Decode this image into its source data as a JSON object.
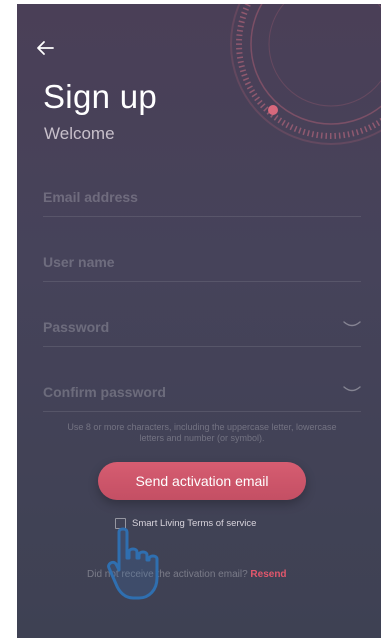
{
  "header": {
    "back_icon": "arrow-left-icon",
    "title": "Sign up",
    "subtitle": "Welcome"
  },
  "form": {
    "email_placeholder": "Email address",
    "username_placeholder": "User name",
    "password_placeholder": "Password",
    "confirm_password_placeholder": "Confirm password",
    "password_hint": "Use 8 or more characters, including the uppercase letter, lowercase letters and number (or symbol).",
    "toggle_icon": "eye-closed-icon"
  },
  "actions": {
    "send_label": "Send activation email",
    "terms_label": "Smart Living Terms of service",
    "resend_prompt": "Did not receive the activation email?",
    "resend_link": "Resend"
  },
  "colors": {
    "accent": "#d05a6d",
    "background_top": "#4a3f57",
    "background_bottom": "#3e4153"
  },
  "overlay": {
    "pointer_icon": "hand-pointer-icon"
  }
}
